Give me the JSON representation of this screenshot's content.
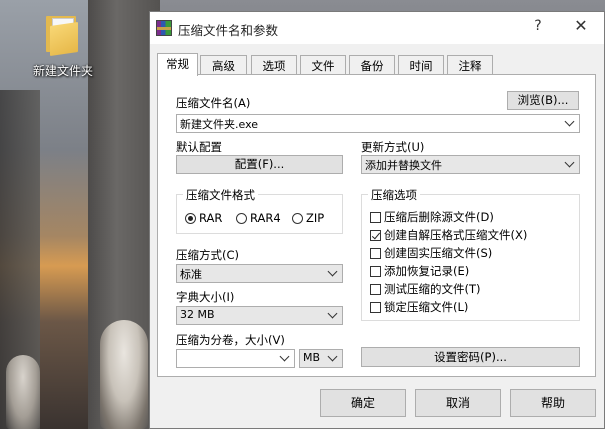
{
  "desktop": {
    "folder_label": "新建文件夹"
  },
  "dialog": {
    "title": "压缩文件名和参数",
    "help_glyph": "?",
    "close_glyph": "✕",
    "tabs": [
      "常规",
      "高级",
      "选项",
      "文件",
      "备份",
      "时间",
      "注释"
    ],
    "active_tab": "常规",
    "archive_name_label": "压缩文件名(A)",
    "archive_name_value": "新建文件夹.exe",
    "browse_label": "浏览(B)...",
    "default_profile_label": "默认配置",
    "profile_button": "配置(F)...",
    "update_mode_label": "更新方式(U)",
    "update_mode_value": "添加并替换文件",
    "format_group": {
      "title": "压缩文件格式",
      "options": [
        "RAR",
        "RAR4",
        "ZIP"
      ],
      "selected": "RAR"
    },
    "options_group": {
      "title": "压缩选项",
      "items": [
        {
          "label": "压缩后删除源文件(D)",
          "checked": false
        },
        {
          "label": "创建自解压格式压缩文件(X)",
          "checked": true
        },
        {
          "label": "创建固实压缩文件(S)",
          "checked": false
        },
        {
          "label": "添加恢复记录(E)",
          "checked": false
        },
        {
          "label": "测试压缩的文件(T)",
          "checked": false
        },
        {
          "label": "锁定压缩文件(L)",
          "checked": false
        }
      ]
    },
    "method_label": "压缩方式(C)",
    "method_value": "标准",
    "dict_label": "字典大小(I)",
    "dict_value": "32 MB",
    "split_label": "压缩为分卷，大小(V)",
    "split_value": "",
    "split_unit": "MB",
    "set_password_button": "设置密码(P)...",
    "ok_button": "确定",
    "cancel_button": "取消",
    "help_button": "帮助"
  }
}
